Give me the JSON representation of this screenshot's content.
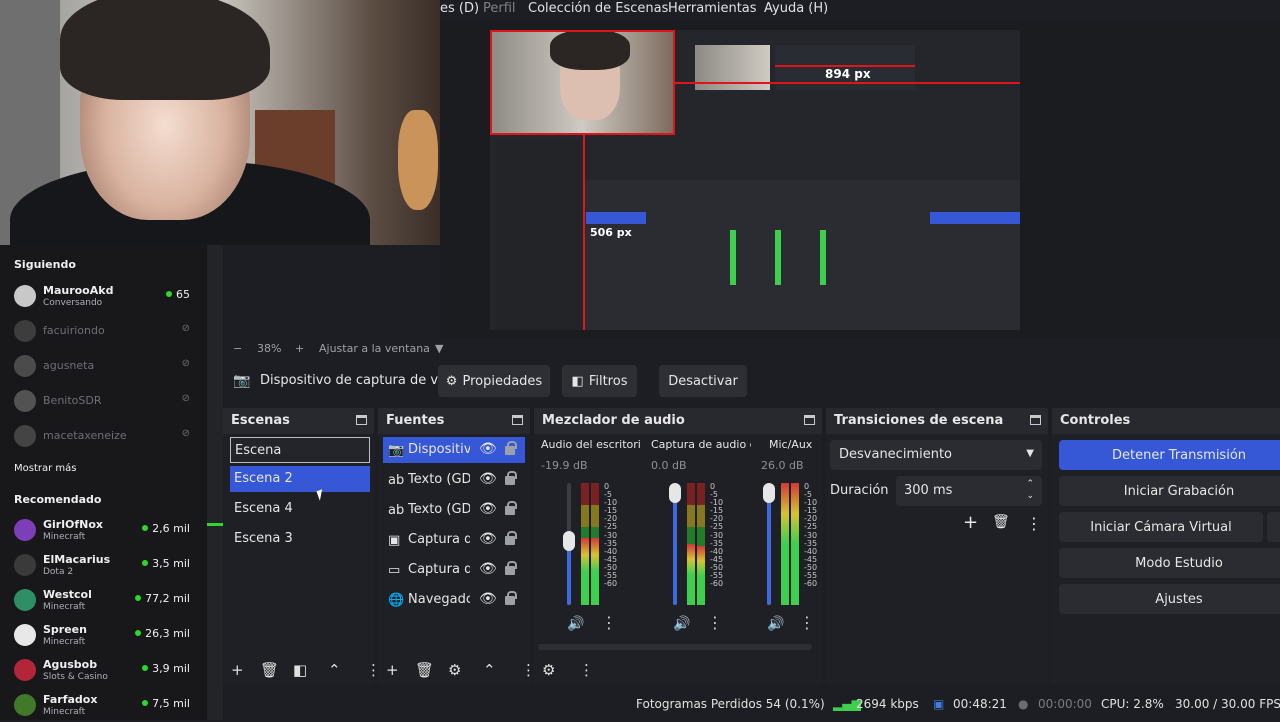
{
  "menu": [
    "es (D)",
    "Perfil",
    "Colección de Escenas",
    "Herramientas",
    "Ayuda (H)"
  ],
  "twitch": {
    "following_title": "Siguiendo",
    "following": [
      {
        "name": "MaurooAkd",
        "game": "Conversando",
        "viewers": "65",
        "live": true
      },
      {
        "name": "facuiriondo",
        "live": false
      },
      {
        "name": "agusneta",
        "live": false
      },
      {
        "name": "BenitoSDR",
        "live": false
      },
      {
        "name": "macetaxeneize",
        "live": false
      }
    ],
    "show_more": "Mostrar más",
    "recommended_title": "Recomendado",
    "recommended": [
      {
        "name": "GirlOfNox",
        "game": "Minecraft",
        "viewers": "2,6 mil"
      },
      {
        "name": "ElMacarius",
        "game": "Dota 2",
        "viewers": "3,5 mil"
      },
      {
        "name": "Westcol",
        "game": "Minecraft",
        "viewers": "77,2 mil"
      },
      {
        "name": "Spreen",
        "game": "Minecraft",
        "viewers": "26,3 mil"
      },
      {
        "name": "Agusbob",
        "game": "Slots & Casino",
        "viewers": "3,9 mil"
      },
      {
        "name": "Farfadox",
        "game": "Minecraft",
        "viewers": "7,5 mil"
      }
    ]
  },
  "preview": {
    "label_894": "894 px",
    "label_506": "506 px"
  },
  "zoom": {
    "minus": "−",
    "value": "38%",
    "plus": "+",
    "fit": "Ajustar a la ventana"
  },
  "context": {
    "source": "Dispositivo de captura de v",
    "properties": "Propiedades",
    "filters": "Filtros",
    "deactivate": "Desactivar"
  },
  "scenes": {
    "title": "Escenas",
    "items": [
      "Escena",
      "Escena 2",
      "Escena 4",
      "Escena 3"
    ]
  },
  "sources": {
    "title": "Fuentes",
    "items": [
      "Dispositiv",
      "Texto (GD",
      "Texto (GD",
      "Captura d",
      "Captura d",
      "Navegadc"
    ]
  },
  "mixer": {
    "title": "Mezclador de audio",
    "channels": [
      {
        "name": "Audio del escritoric",
        "db": "-19.9 dB",
        "level": 0.55
      },
      {
        "name": "Captura de audio c",
        "db": "0.0 dB",
        "level": 0.9
      },
      {
        "name": "Mic/Aux",
        "db": "26.0 dB",
        "level": 0.9
      }
    ],
    "scale": [
      "0",
      "-5",
      "-10",
      "-15",
      "-20",
      "-25",
      "-30",
      "-35",
      "-40",
      "-45",
      "-50",
      "-55",
      "-60"
    ]
  },
  "transitions": {
    "title": "Transiciones de escena",
    "selected": "Desvanecimiento",
    "duration_label": "Duración",
    "duration_value": "300 ms"
  },
  "controls": {
    "title": "Controles",
    "buttons": [
      "Detener Transmisión",
      "Iniciar Grabación",
      "Iniciar Cámara Virtual",
      "Modo Estudio",
      "Ajustes"
    ]
  },
  "status": {
    "dropped": "Fotogramas Perdidos 54 (0.1%)",
    "bitrate": "2694 kbps",
    "live_time": "00:48:21",
    "rec_time": "00:00:00",
    "cpu": "CPU: 2.8%",
    "fps": "30.00 / 30.00 FPS"
  },
  "colors": {
    "accent": "#3657d6",
    "live": "#2bd92b",
    "guide": "#e0151b"
  }
}
